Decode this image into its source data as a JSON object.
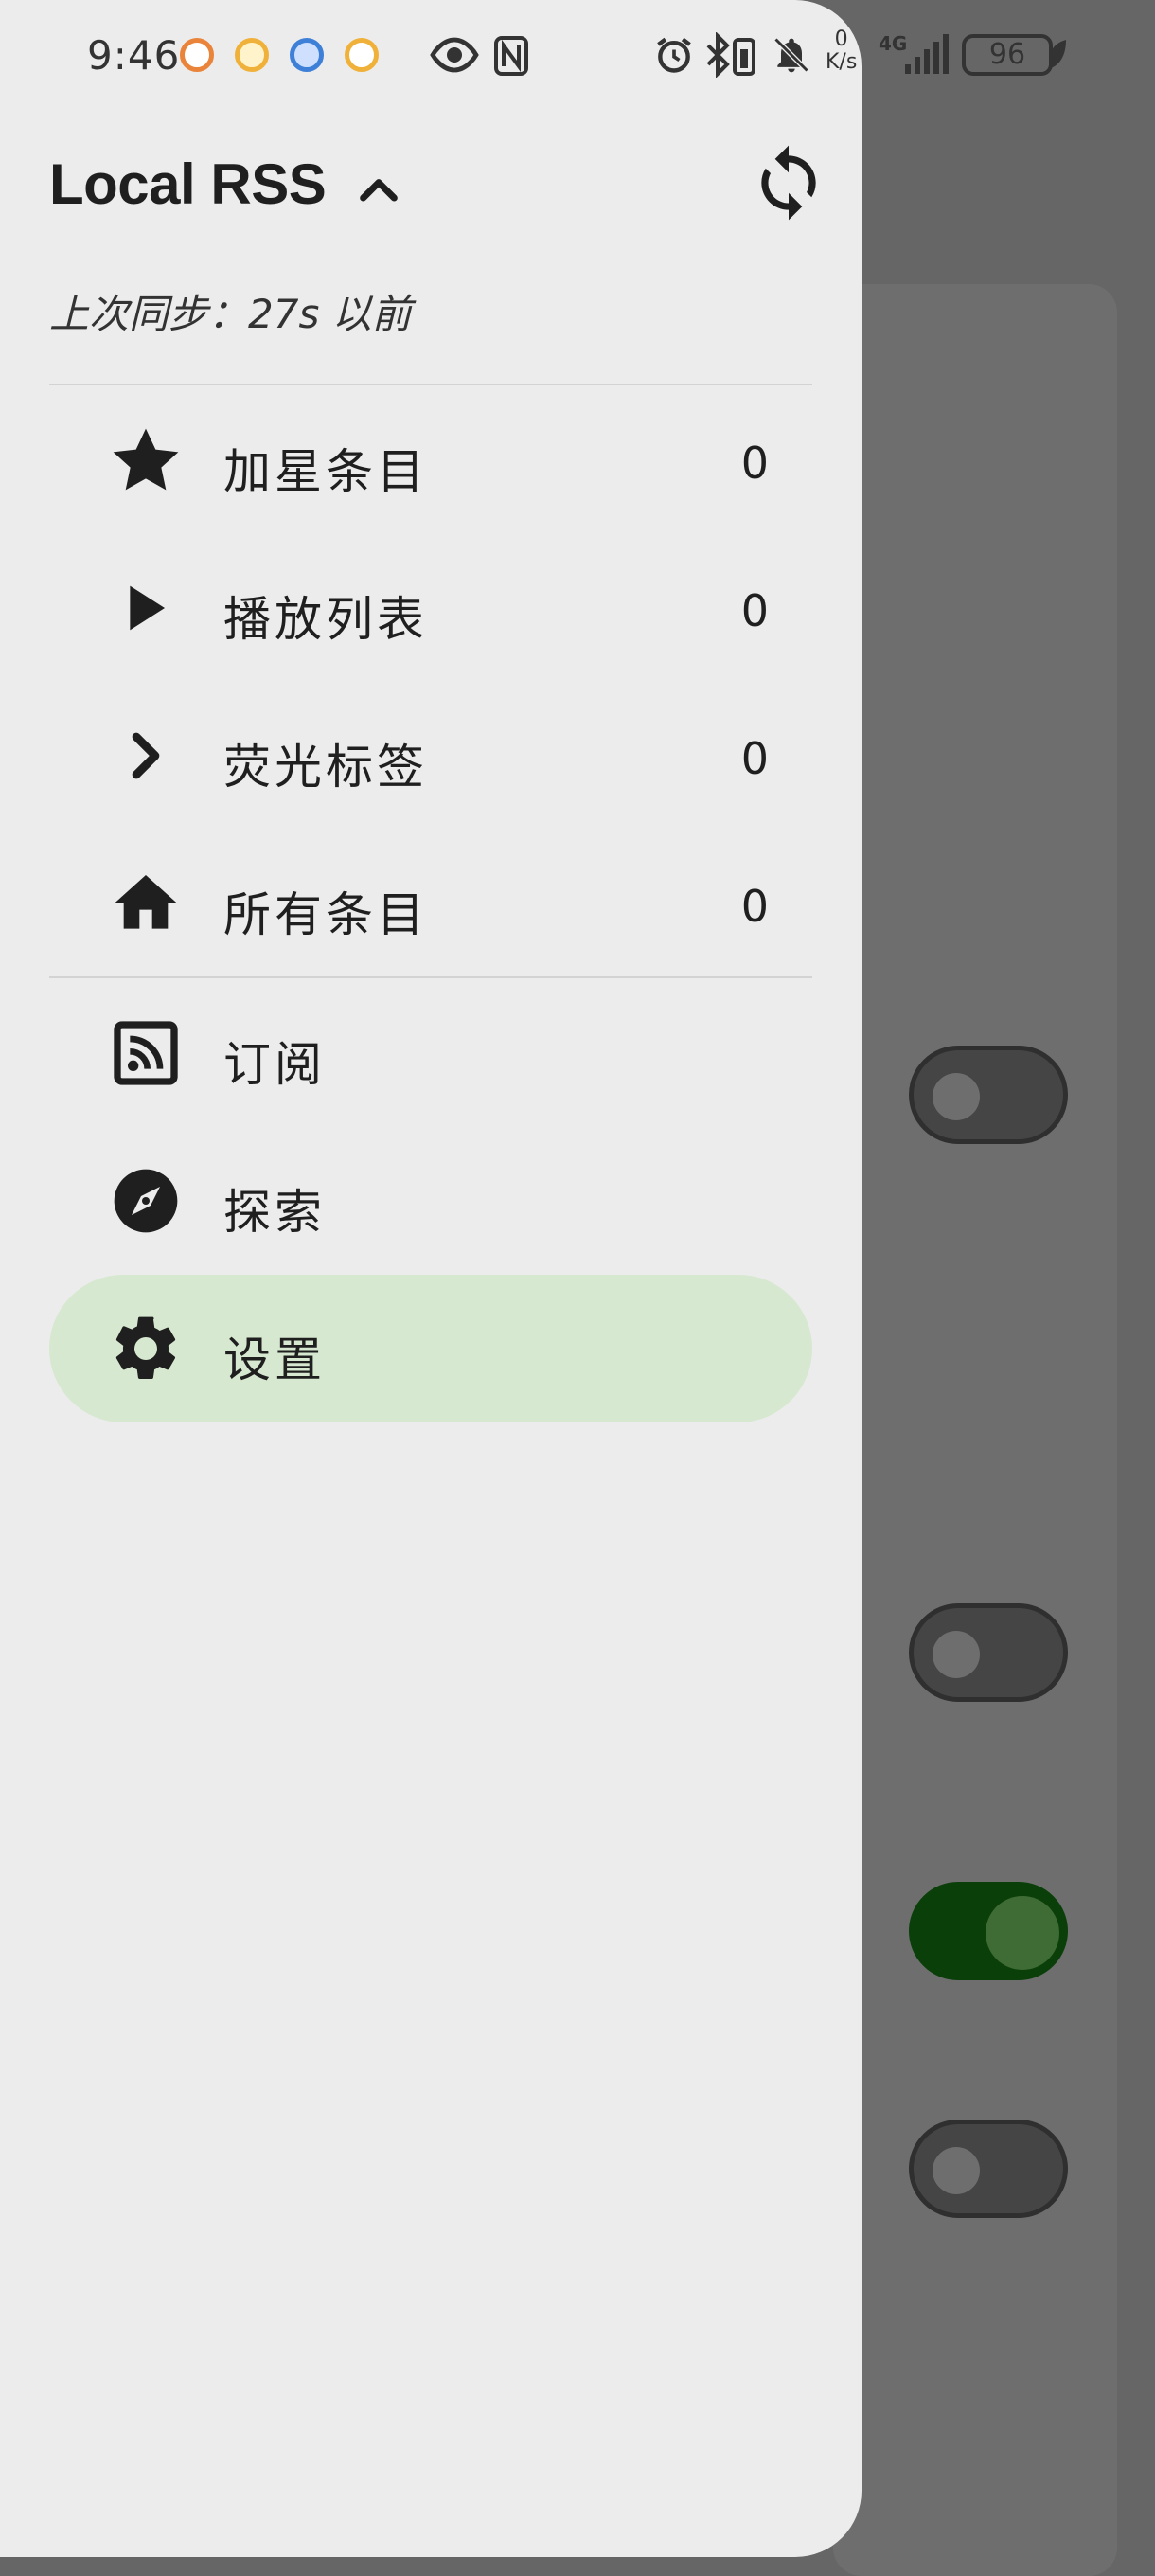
{
  "status_bar": {
    "time": "9:46",
    "net_speed_value": "0",
    "net_speed_unit": "K/s",
    "network_type": "4G",
    "battery": "96"
  },
  "drawer": {
    "account_title": "Local RSS",
    "sync_time": "上次同步：27s 以前",
    "counters": [
      {
        "label": "加星条目",
        "count": "0",
        "icon": "star-icon"
      },
      {
        "label": "播放列表",
        "count": "0",
        "icon": "play-icon"
      },
      {
        "label": "荧光标签",
        "count": "0",
        "icon": "chevron-right-icon"
      },
      {
        "label": "所有条目",
        "count": "0",
        "icon": "home-icon"
      }
    ],
    "links": [
      {
        "label": "订阅",
        "icon": "rss-feed-icon"
      },
      {
        "label": "探索",
        "icon": "compass-icon"
      },
      {
        "label": "设置",
        "icon": "gear-icon",
        "selected": true
      }
    ]
  },
  "background": {
    "toggles": [
      false,
      false,
      true,
      false
    ]
  },
  "colors": {
    "drawer_bg": "#ececec",
    "selected_bg": "#d6e8cf",
    "scrim": "#666666",
    "toggle_on": "#0a3f0a"
  }
}
